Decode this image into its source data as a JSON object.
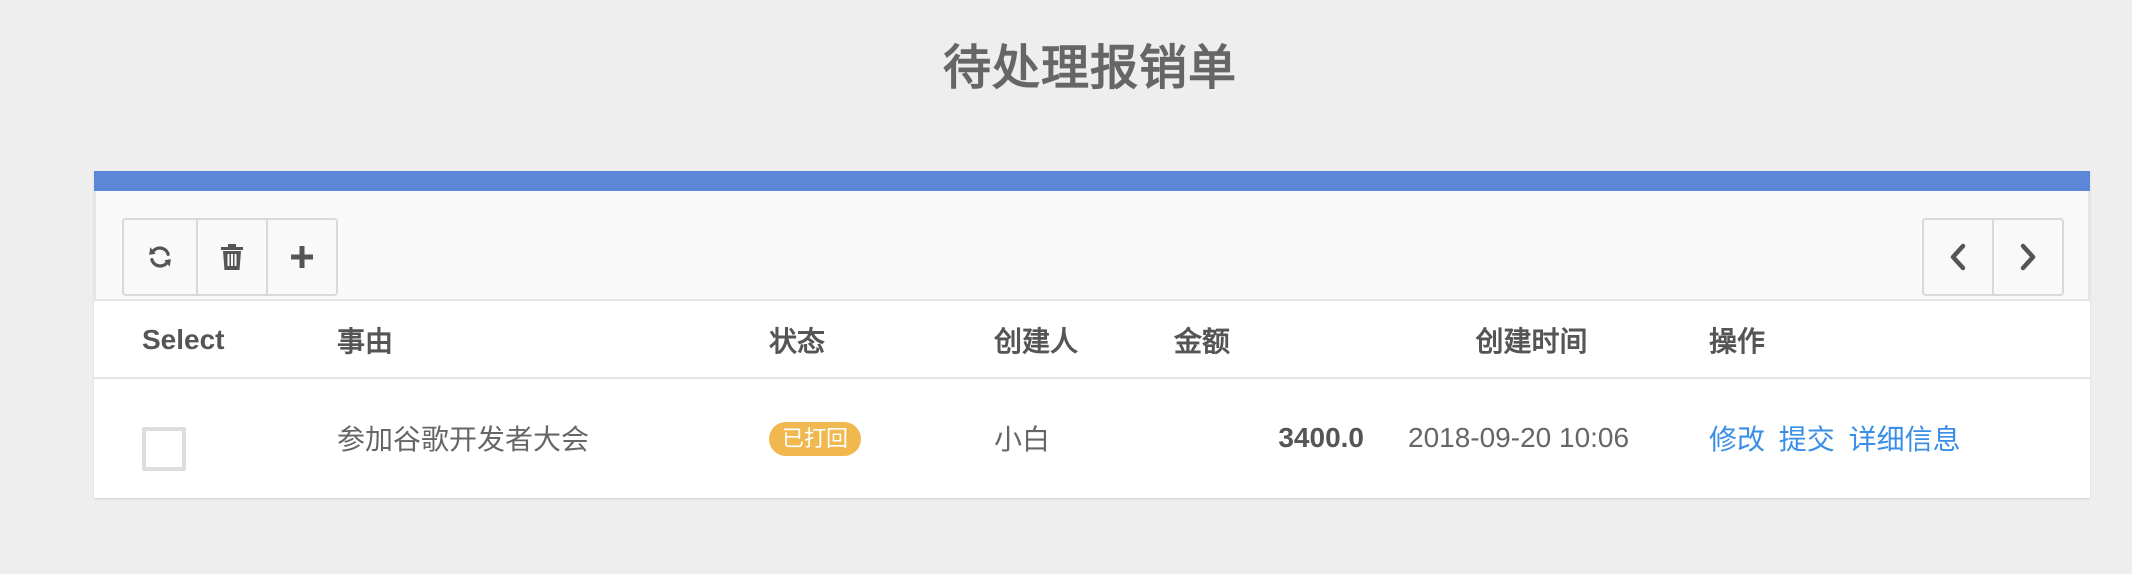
{
  "page": {
    "title": "待处理报销单"
  },
  "toolbar": {
    "left_buttons": [
      {
        "icon": "refresh-icon"
      },
      {
        "icon": "trash-icon"
      },
      {
        "icon": "plus-icon"
      }
    ],
    "right_buttons": [
      {
        "icon": "chevron-left-icon"
      },
      {
        "icon": "chevron-right-icon"
      }
    ]
  },
  "table": {
    "headers": {
      "select": "Select",
      "reason": "事由",
      "status": "状态",
      "creator": "创建人",
      "amount": "金额",
      "created_time": "创建时间",
      "actions": "操作"
    },
    "rows": [
      {
        "checked": false,
        "reason": "参加谷歌开发者大会",
        "status": "已打回",
        "creator": "小白",
        "amount": "3400.0",
        "created_time": "2018-09-20 10:06",
        "actions": {
          "edit": "修改",
          "submit": "提交",
          "details": "详细信息"
        }
      }
    ]
  },
  "colors": {
    "accent_bar": "#5b87d6",
    "status_badge": "#f0b84f",
    "link": "#3a8ee6",
    "background": "#eeeeee"
  }
}
